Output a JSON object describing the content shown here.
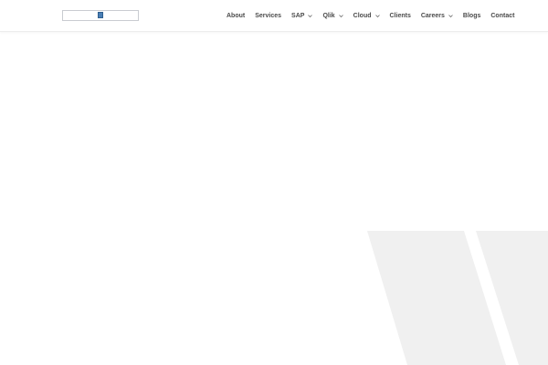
{
  "header": {
    "logo_alt": "company-logo",
    "nav": [
      {
        "label": "About",
        "dropdown": false
      },
      {
        "label": "Services",
        "dropdown": false
      },
      {
        "label": "SAP",
        "dropdown": true
      },
      {
        "label": "Qlik",
        "dropdown": true
      },
      {
        "label": "Cloud",
        "dropdown": true
      },
      {
        "label": "Clients",
        "dropdown": false
      },
      {
        "label": "Careers",
        "dropdown": true
      },
      {
        "label": "Blogs",
        "dropdown": false
      },
      {
        "label": "Contact",
        "dropdown": false
      }
    ]
  },
  "colors": {
    "nav_text": "#4a4a4a",
    "background": "#ffffff",
    "decor_stripes": "#f0f0f0",
    "header_border": "#ededed"
  }
}
